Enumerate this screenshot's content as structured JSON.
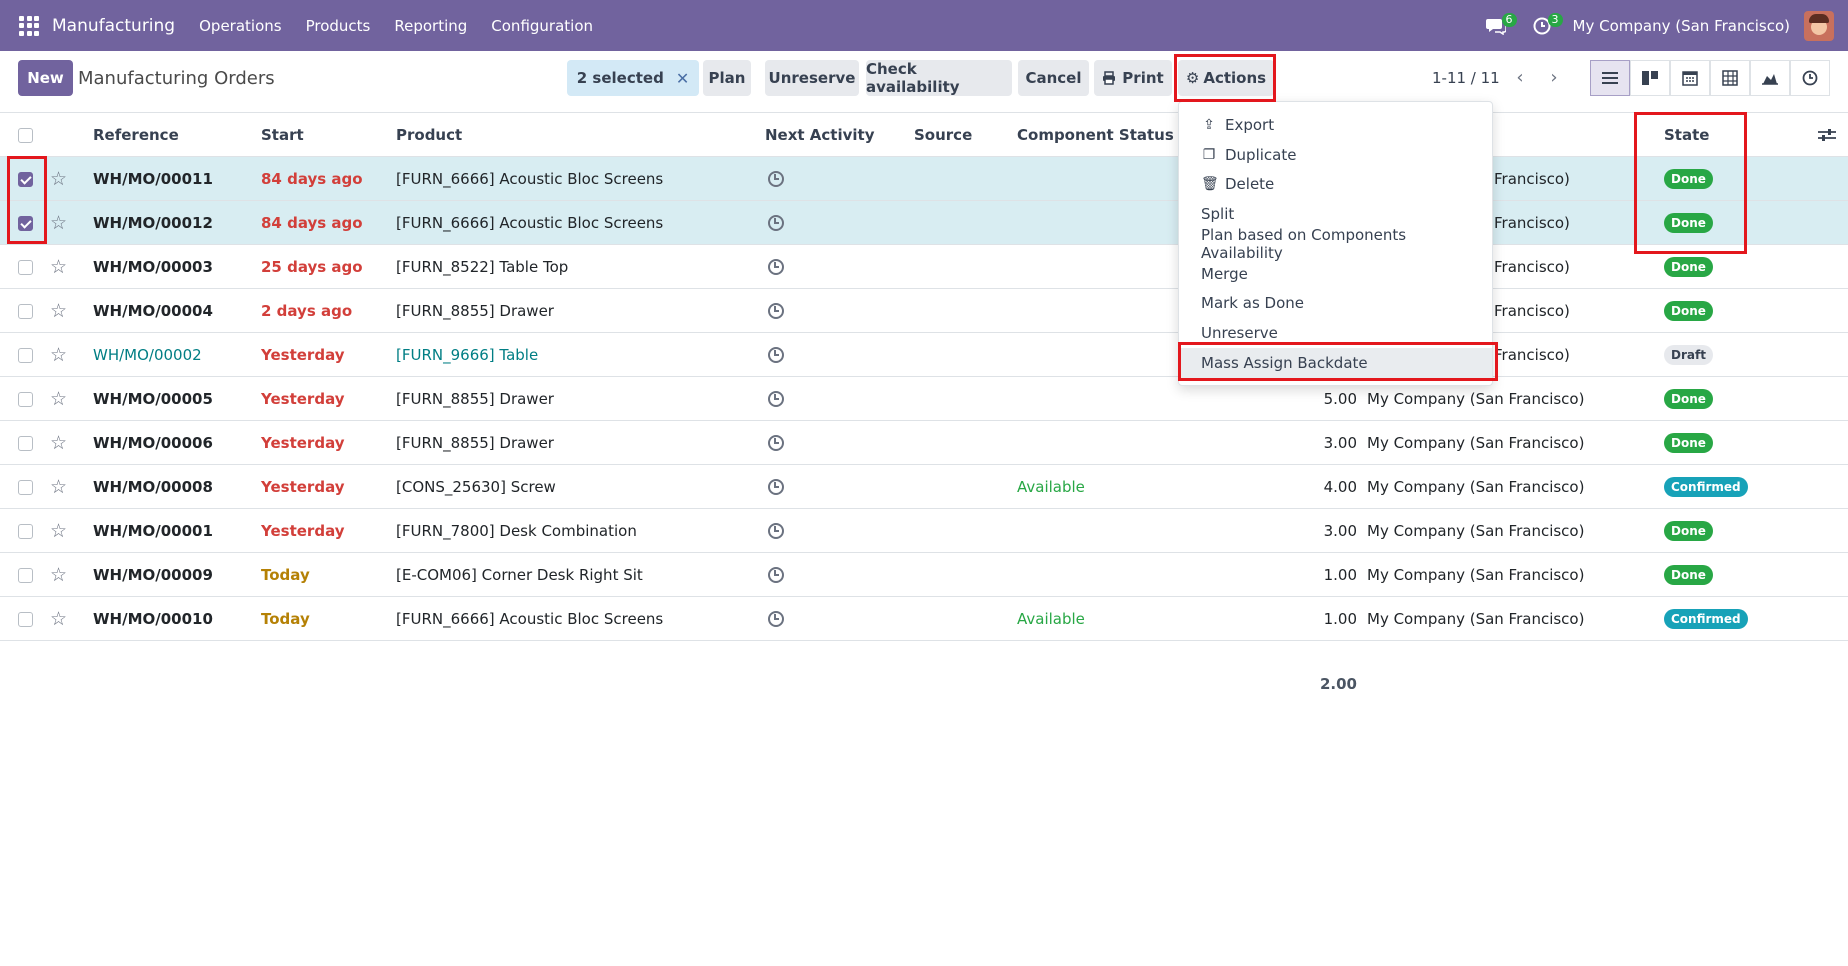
{
  "navbar": {
    "brand": "Manufacturing",
    "menus": [
      "Operations",
      "Products",
      "Reporting",
      "Configuration"
    ],
    "messages_count": "6",
    "activities_count": "3",
    "company": "My Company (San Francisco)"
  },
  "control": {
    "new_label": "New",
    "title": "Manufacturing Orders",
    "selected_label": "2 selected",
    "plan_label": "Plan",
    "unreserve_label": "Unreserve",
    "check_label": "Check availability",
    "cancel_label": "Cancel",
    "print_label": "Print",
    "actions_label": "Actions",
    "pager": "1-11 / 11"
  },
  "columns": {
    "reference": "Reference",
    "start": "Start",
    "product": "Product",
    "next_activity": "Next Activity",
    "source": "Source",
    "component_status": "Component Status",
    "state": "State"
  },
  "rows": [
    {
      "ref": "WH/MO/00011",
      "start": "84 days ago",
      "product": "[FURN_6666] Acoustic Bloc Screens",
      "component": "",
      "qty": "",
      "company": "Francisco)",
      "state": "Done",
      "checked": true
    },
    {
      "ref": "WH/MO/00012",
      "start": "84 days ago",
      "product": "[FURN_6666] Acoustic Bloc Screens",
      "component": "",
      "qty": "",
      "company": "Francisco)",
      "state": "Done",
      "checked": true
    },
    {
      "ref": "WH/MO/00003",
      "start": "25 days ago",
      "product": "[FURN_8522] Table Top",
      "component": "",
      "qty": "",
      "company": "Francisco)",
      "state": "Done",
      "checked": false
    },
    {
      "ref": "WH/MO/00004",
      "start": "2 days ago",
      "product": "[FURN_8855] Drawer",
      "component": "",
      "qty": "",
      "company": "Francisco)",
      "state": "Done",
      "checked": false
    },
    {
      "ref": "WH/MO/00002",
      "start": "Yesterday",
      "product": "[FURN_9666] Table",
      "component": "",
      "qty": "",
      "company": "Francisco)",
      "state": "Draft",
      "checked": false
    },
    {
      "ref": "WH/MO/00005",
      "start": "Yesterday",
      "product": "[FURN_8855] Drawer",
      "component": "",
      "qty": "5.00",
      "company": "My Company (San Francisco)",
      "state": "Done",
      "checked": false
    },
    {
      "ref": "WH/MO/00006",
      "start": "Yesterday",
      "product": "[FURN_8855] Drawer",
      "component": "",
      "qty": "3.00",
      "company": "My Company (San Francisco)",
      "state": "Done",
      "checked": false
    },
    {
      "ref": "WH/MO/00008",
      "start": "Yesterday",
      "product": "[CONS_25630] Screw",
      "component": "Available",
      "qty": "4.00",
      "company": "My Company (San Francisco)",
      "state": "Confirmed",
      "checked": false
    },
    {
      "ref": "WH/MO/00001",
      "start": "Yesterday",
      "product": "[FURN_7800] Desk Combination",
      "component": "",
      "qty": "3.00",
      "company": "My Company (San Francisco)",
      "state": "Done",
      "checked": false
    },
    {
      "ref": "WH/MO/00009",
      "start": "Today",
      "product": "[E-COM06] Corner Desk Right Sit",
      "component": "",
      "qty": "1.00",
      "company": "My Company (San Francisco)",
      "state": "Done",
      "checked": false
    },
    {
      "ref": "WH/MO/00010",
      "start": "Today",
      "product": "[FURN_6666] Acoustic Bloc Screens",
      "component": "Available",
      "qty": "1.00",
      "company": "My Company (San Francisco)",
      "state": "Confirmed",
      "checked": false
    }
  ],
  "total_qty": "2.00",
  "actions_menu": [
    "Export",
    "Duplicate",
    "Delete",
    "Split",
    "Plan based on Components Availability",
    "Merge",
    "Mark as Done",
    "Unreserve",
    "Mass Assign Backdate"
  ],
  "colors": {
    "brand": "#71639e",
    "done": "#28a745",
    "confirmed": "#17a2b8",
    "highlight": "#e3171d"
  }
}
